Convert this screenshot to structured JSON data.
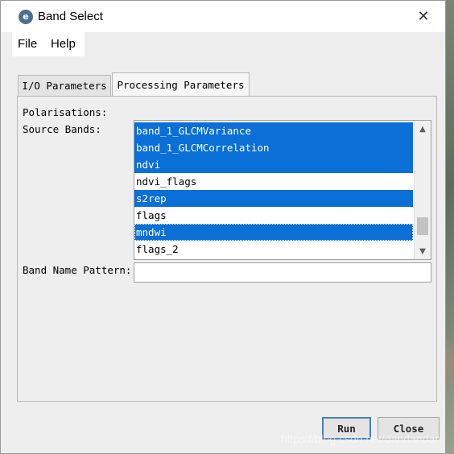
{
  "window": {
    "title": "Band Select",
    "app_icon": "snap-icon"
  },
  "menu": {
    "items": [
      "File",
      "Help"
    ]
  },
  "tabs": [
    {
      "label": "I/O Parameters",
      "active": false
    },
    {
      "label": "Processing Parameters",
      "active": true
    }
  ],
  "form": {
    "polarisations_label": "Polarisations:",
    "source_bands_label": "Source Bands:",
    "band_name_pattern_label": "Band Name Pattern:",
    "band_name_pattern_value": ""
  },
  "source_bands": [
    {
      "name": "band_1_GLCMVariance",
      "selected": true
    },
    {
      "name": "band_1_GLCMCorrelation",
      "selected": true
    },
    {
      "name": "ndvi",
      "selected": true
    },
    {
      "name": "ndvi_flags",
      "selected": false
    },
    {
      "name": "s2rep",
      "selected": true
    },
    {
      "name": "flags",
      "selected": false
    },
    {
      "name": "mndwi",
      "selected": true,
      "focused": true
    },
    {
      "name": "flags_2",
      "selected": false
    }
  ],
  "buttons": {
    "run": "Run",
    "close": "Close"
  },
  "watermark": "https://blog.csdn.net/dandandan",
  "colors": {
    "selection": "#0a6fd6",
    "default_button_border": "#4a7fb8"
  }
}
